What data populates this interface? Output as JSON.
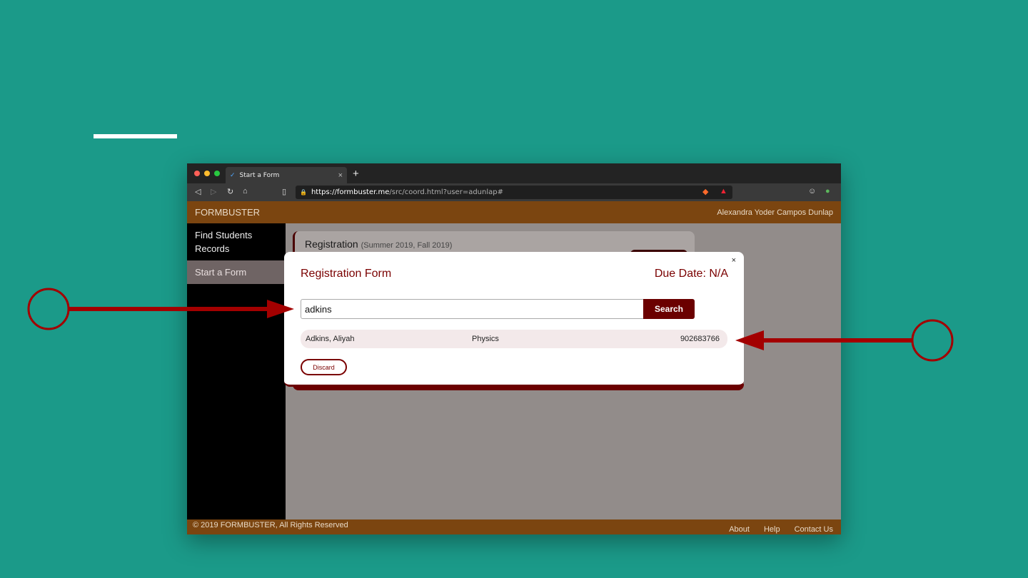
{
  "browser": {
    "tab_title": "Start a Form",
    "tab_close": "×",
    "new_tab": "+",
    "url_scheme": "https://",
    "url_host": "formbuster.me",
    "url_path": "/src/coord.html?user=adunlap#"
  },
  "app": {
    "brand": "FORMBUSTER",
    "user_name": "Alexandra Yoder Campos Dunlap"
  },
  "sidebar": {
    "items": [
      {
        "label": "Find Students Records"
      },
      {
        "label": "Start a Form"
      }
    ]
  },
  "registration": {
    "title": "Registration",
    "subtitle": "(Summer 2019, Fall 2019)"
  },
  "modal": {
    "close": "×",
    "title": "Registration Form",
    "due_date": "Due Date: N/A",
    "search_value": "adkins",
    "search_button": "Search",
    "result": {
      "name": "Adkins, Aliyah",
      "department": "Physics",
      "id": "902683766"
    },
    "discard_button": "Discard"
  },
  "footer": {
    "copyright": "© 2019 FORMBUSTER, All Rights Reserved",
    "links": [
      "About",
      "Help",
      "Contact Us"
    ]
  },
  "colors": {
    "background": "#1b9a89",
    "brand": "#7b4510",
    "accent": "#7a0000",
    "annotation": "#a30000"
  }
}
